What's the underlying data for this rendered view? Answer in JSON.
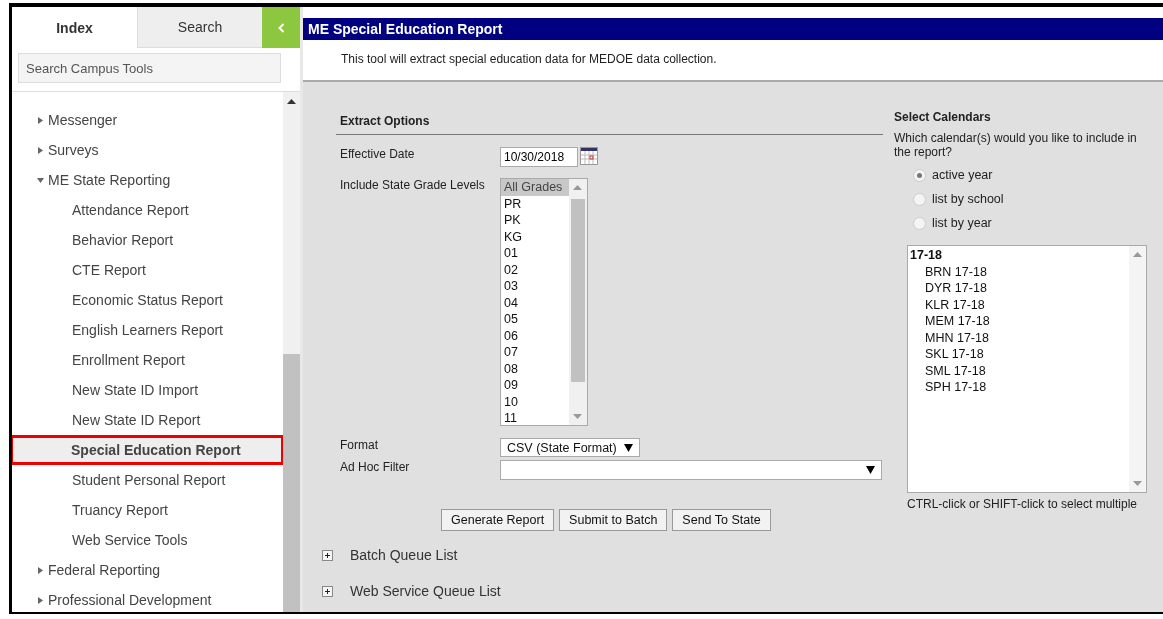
{
  "sidebar": {
    "tabs": [
      {
        "label": "Index",
        "selected": true
      },
      {
        "label": "Search",
        "selected": false
      }
    ],
    "search": {
      "placeholder": "Search Campus Tools"
    },
    "tree": [
      {
        "label": "Messenger",
        "expanded": false
      },
      {
        "label": "Surveys",
        "expanded": false
      },
      {
        "label": "ME State Reporting",
        "expanded": true,
        "children": [
          {
            "label": "Attendance Report",
            "selected": false
          },
          {
            "label": "Behavior Report",
            "selected": false
          },
          {
            "label": "CTE Report",
            "selected": false
          },
          {
            "label": "Economic Status Report",
            "selected": false
          },
          {
            "label": "English Learners Report",
            "selected": false
          },
          {
            "label": "Enrollment Report",
            "selected": false
          },
          {
            "label": "New State ID Import",
            "selected": false
          },
          {
            "label": "New State ID Report",
            "selected": false
          },
          {
            "label": "Special Education Report",
            "selected": true
          },
          {
            "label": "Student Personal Report",
            "selected": false
          },
          {
            "label": "Truancy Report",
            "selected": false
          },
          {
            "label": "Web Service Tools",
            "selected": false
          }
        ]
      },
      {
        "label": "Federal Reporting",
        "expanded": false
      },
      {
        "label": "Professional Development",
        "expanded": false
      }
    ]
  },
  "report": {
    "title": "ME Special Education Report",
    "description": "This tool will extract special education data for MEDOE data collection.",
    "extract_options": {
      "heading": "Extract Options",
      "effective_date": {
        "label": "Effective Date",
        "value": "10/30/2018"
      },
      "grade_levels": {
        "label": "Include State Grade Levels",
        "options": [
          {
            "label": "All Grades",
            "selected": true
          },
          {
            "label": "PR",
            "selected": false
          },
          {
            "label": "PK",
            "selected": false
          },
          {
            "label": "KG",
            "selected": false
          },
          {
            "label": "01",
            "selected": false
          },
          {
            "label": "02",
            "selected": false
          },
          {
            "label": "03",
            "selected": false
          },
          {
            "label": "04",
            "selected": false
          },
          {
            "label": "05",
            "selected": false
          },
          {
            "label": "06",
            "selected": false
          },
          {
            "label": "07",
            "selected": false
          },
          {
            "label": "08",
            "selected": false
          },
          {
            "label": "09",
            "selected": false
          },
          {
            "label": "10",
            "selected": false
          },
          {
            "label": "11",
            "selected": false
          }
        ]
      },
      "format": {
        "label": "Format",
        "value": "CSV (State Format)"
      },
      "ad_hoc_filter": {
        "label": "Ad Hoc Filter"
      }
    },
    "buttons": [
      "Generate Report",
      "Submit to Batch",
      "Send To State"
    ],
    "sections": [
      {
        "label": "Batch Queue List",
        "expanded": false
      },
      {
        "label": "Web Service Queue List",
        "expanded": false
      }
    ],
    "calendars": {
      "heading": "Select Calendars",
      "question": "Which calendar(s) would you like to include in the report?",
      "modes": [
        {
          "label": "active year",
          "selected": true
        },
        {
          "label": "list by school",
          "selected": false
        },
        {
          "label": "list by year",
          "selected": false
        }
      ],
      "list": [
        {
          "label": "17-18",
          "children": [
            {
              "label": "BRN 17-18",
              "selected": false
            },
            {
              "label": "DYR 17-18",
              "selected": false
            },
            {
              "label": "KLR 17-18",
              "selected": false
            },
            {
              "label": "MEM 17-18",
              "selected": false
            },
            {
              "label": "MHN 17-18",
              "selected": false
            },
            {
              "label": "SKL 17-18",
              "selected": false
            },
            {
              "label": "SML 17-18",
              "selected": false
            },
            {
              "label": "SPH 17-18",
              "selected": false
            }
          ]
        }
      ],
      "hint": "CTRL-click or SHIFT-click to select multiple"
    }
  }
}
